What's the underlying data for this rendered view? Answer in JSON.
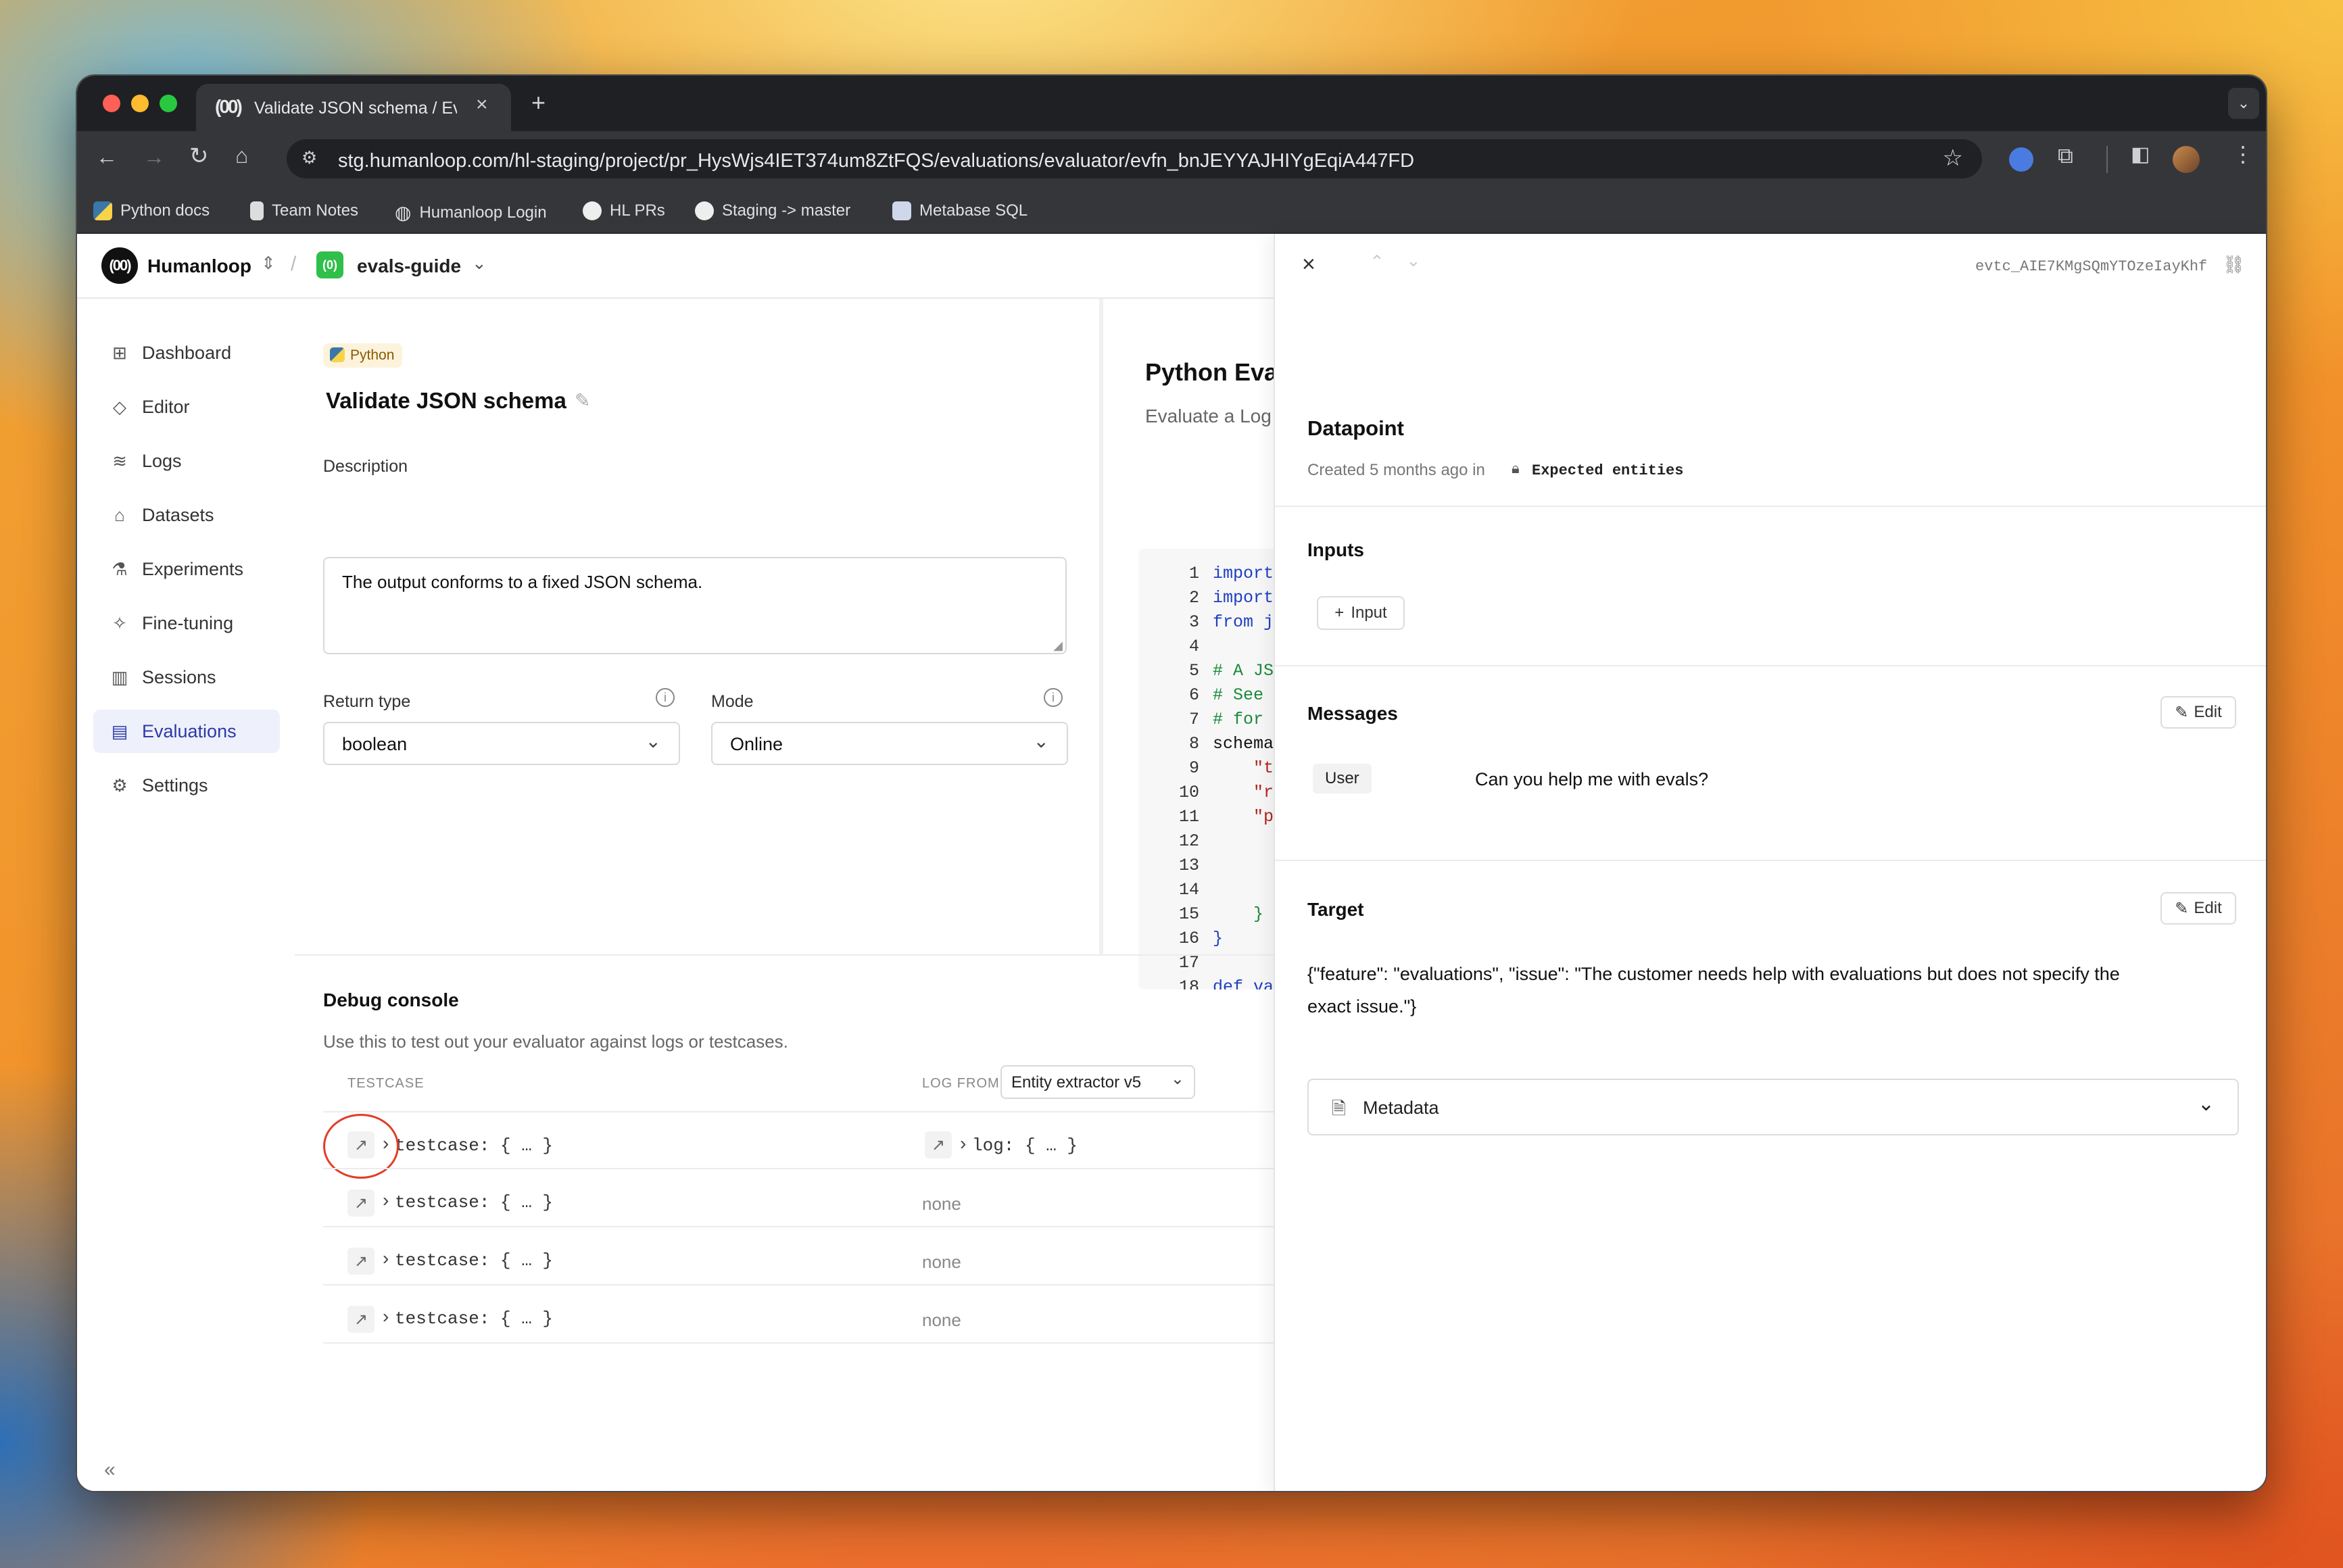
{
  "browser": {
    "tab_title": "Validate JSON schema / Evalu",
    "new_tab": "+",
    "url": "stg.humanloop.com/hl-staging/project/pr_HysWjs4IET374um8ZtFQS/evaluations/evaluator/evfn_bnJEYYAJHIYgEqiA447FD",
    "bookmarks": [
      "Python docs",
      "Team Notes",
      "Humanloop Login",
      "HL PRs",
      "Staging -> master",
      "Metabase SQL"
    ]
  },
  "header": {
    "org": "Humanloop",
    "project": "evals-guide",
    "separator": "/"
  },
  "sidebar": {
    "items": [
      {
        "label": "Dashboard",
        "icon": "grid-icon"
      },
      {
        "label": "Editor",
        "icon": "editor-icon"
      },
      {
        "label": "Logs",
        "icon": "database-icon"
      },
      {
        "label": "Datasets",
        "icon": "dataset-icon"
      },
      {
        "label": "Experiments",
        "icon": "flask-icon"
      },
      {
        "label": "Fine-tuning",
        "icon": "sparkle-icon"
      },
      {
        "label": "Sessions",
        "icon": "columns-icon"
      },
      {
        "label": "Evaluations",
        "icon": "clipboard-icon",
        "active": true
      },
      {
        "label": "Settings",
        "icon": "gear-icon"
      }
    ]
  },
  "evaluator": {
    "badge": "Python",
    "title": "Validate JSON schema",
    "description_label": "Description",
    "description": "The output conforms to a fixed JSON schema.",
    "return_type_label": "Return type",
    "return_type": "boolean",
    "mode_label": "Mode",
    "mode": "Online"
  },
  "code_panel": {
    "title": "Python Eva",
    "subtitle": "Evaluate a Log",
    "lines": [
      {
        "n": "1",
        "t": "import j"
      },
      {
        "n": "2",
        "t": "import j"
      },
      {
        "n": "3",
        "t": "from jsc"
      },
      {
        "n": "4",
        "t": ""
      },
      {
        "n": "5",
        "t": "# A JSON"
      },
      {
        "n": "6",
        "t": "# See ht"
      },
      {
        "n": "7",
        "t": "# for mo"
      },
      {
        "n": "8",
        "t": "schema ="
      },
      {
        "n": "9",
        "t": "    \"typ"
      },
      {
        "n": "10",
        "t": "    \"rec"
      },
      {
        "n": "11",
        "t": "    \"pro"
      },
      {
        "n": "12",
        "t": ""
      },
      {
        "n": "13",
        "t": ""
      },
      {
        "n": "14",
        "t": ""
      },
      {
        "n": "15",
        "t": "    }"
      },
      {
        "n": "16",
        "t": "}"
      },
      {
        "n": "17",
        "t": ""
      },
      {
        "n": "18",
        "t": "def vali"
      }
    ]
  },
  "debug": {
    "title": "Debug console",
    "subtitle": "Use this to test out your evaluator against logs or testcases.",
    "col_testcase": "TESTCASE",
    "col_log_from": "LOG FROM",
    "log_source": "Entity extractor v5",
    "rows": [
      {
        "testcase": "testcase: { … }",
        "log": "log: { … }"
      },
      {
        "testcase": "testcase: { … }",
        "log": "none"
      },
      {
        "testcase": "testcase: { … }",
        "log": "none"
      },
      {
        "testcase": "testcase: { … }",
        "log": "none"
      }
    ]
  },
  "datapoint": {
    "id": "evtc_AIE7KMgSQmYTOzeIayKhf",
    "title": "Datapoint",
    "created": "Created 5 months ago in",
    "dataset": "Expected entities",
    "inputs_label": "Inputs",
    "add_input": "Input",
    "messages_label": "Messages",
    "edit": "Edit",
    "message_role": "User",
    "message_text": "Can you help me with evals?",
    "target_label": "Target",
    "target_line1": "{\"feature\": \"evaluations\", \"issue\": \"The customer needs help with evaluations but does not specify the",
    "target_line2": "exact issue.\"}",
    "metadata_label": "Metadata"
  },
  "colors": {
    "accent": "#2b3aa8",
    "annotation": "#e23d28",
    "python_badge": "#fdf3dc"
  }
}
